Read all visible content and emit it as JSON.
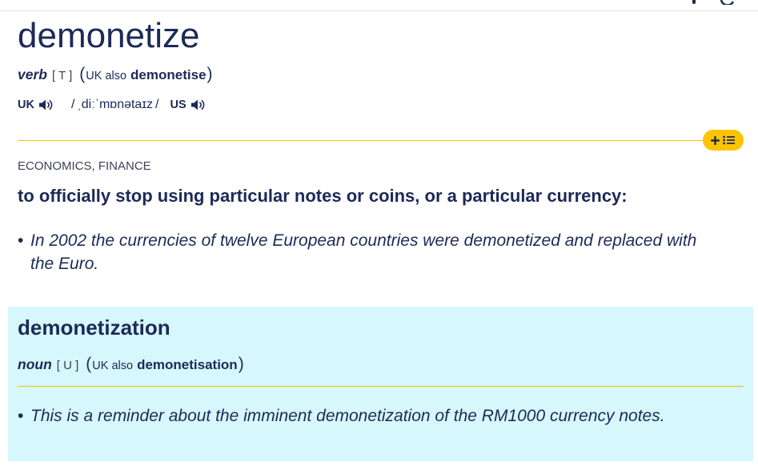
{
  "entry": {
    "headword": "demonetize",
    "pos": "verb",
    "grammar": "[ T ]",
    "variant": {
      "open": "(",
      "region": "UK also",
      "spelling": "demonetise",
      "close": ")"
    },
    "pronunciation": {
      "uk_label": "UK",
      "ipa_open": "/",
      "ipa": "ˌdiːˈmɒnətaɪz",
      "ipa_close": "/",
      "us_label": "US"
    }
  },
  "sense": {
    "domain_labels": "ECONOMICS, FINANCE",
    "definition": "to officially stop using particular notes or coins, or a particular currency:",
    "example_bullet": "•",
    "example": "In 2002 the currencies of twelve European countries were demonetized and replaced with the Euro."
  },
  "runon": {
    "headword": "demonetization",
    "pos": "noun",
    "grammar": "[ U ]",
    "variant": {
      "open": "(",
      "region": "UK also",
      "spelling": "demonetisation",
      "close": ")"
    },
    "example_bullet": "•",
    "example": "This is a reminder about the imminent demonetization of the RM1000 currency notes."
  },
  "icons": {
    "audio": "speaker-icon",
    "add": "plus-icon",
    "word_list": "list-icon"
  },
  "colors": {
    "ink": "#1d2a57",
    "accent": "#fec400",
    "runon_background": "#d6f7fc",
    "divider": "#e3e3e3",
    "muted_text": "#3d4258"
  }
}
